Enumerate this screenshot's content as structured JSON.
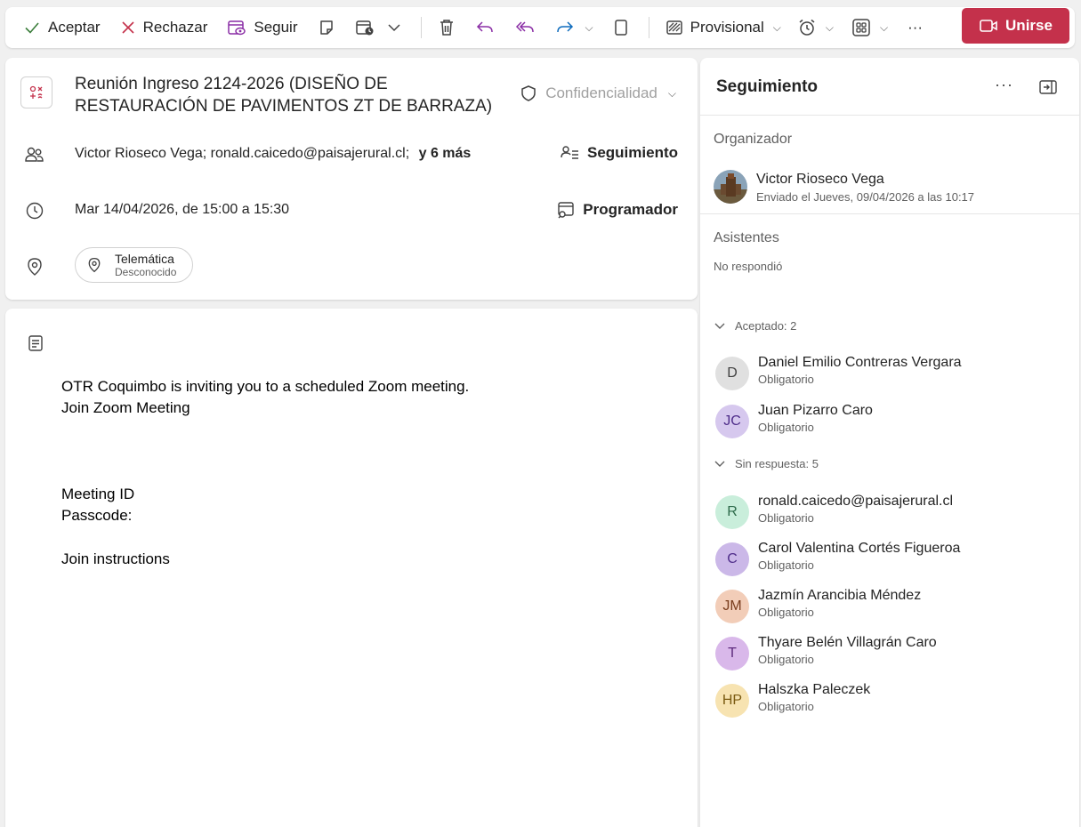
{
  "toolbar": {
    "accept": "Aceptar",
    "reject": "Rechazar",
    "follow": "Seguir",
    "provisional": "Provisional",
    "join": "Unirse",
    "more": "···"
  },
  "event": {
    "title": "Reunión Ingreso 2124-2026 (DISEÑO DE RESTAURACIÓN DE PAVIMENTOS ZT DE BARRAZA)",
    "confidentiality": "Confidencialidad",
    "attendees_summary": "Victor Rioseco Vega;  ronald.caicedo@paisajerural.cl;",
    "attendees_more": "y 6 más",
    "tracking_label": "Seguimiento",
    "datetime": "Mar 14/04/2026, de 15:00 a 15:30",
    "scheduler_label": "Programador",
    "location_name": "Telemática",
    "location_status": "Desconocido"
  },
  "body": {
    "line1": "OTR Coquimbo is inviting you to a scheduled Zoom meeting.",
    "line2": "Join Zoom Meeting",
    "line3": "Meeting ID",
    "line4": "Passcode:",
    "line5": "Join instructions"
  },
  "sidebar": {
    "title": "Seguimiento",
    "more": "···",
    "organizer_label": "Organizador",
    "organizer_name": "Victor Rioseco Vega",
    "organizer_sent": "Enviado el Jueves, 09/04/2026 a las 10:17",
    "attendees_label": "Asistentes",
    "no_response": "No respondió",
    "accepted_header": "Aceptado: 2",
    "pending_header": "Sin respuesta: 5",
    "accepted": [
      {
        "initials": "D",
        "name": "Daniel Emilio Contreras Vergara",
        "role": "Obligatorio",
        "color": "#e0e0e0",
        "text_color": "#424242"
      },
      {
        "initials": "JC",
        "name": "Juan Pizarro Caro",
        "role": "Obligatorio",
        "color": "#d6c8ee",
        "text_color": "#4f2d8a"
      }
    ],
    "pending": [
      {
        "initials": "R",
        "name": "ronald.caicedo@paisajerural.cl",
        "role": "Obligatorio",
        "color": "#c9eedb",
        "text_color": "#2e6b4b"
      },
      {
        "initials": "C",
        "name": "Carol Valentina Cortés Figueroa",
        "role": "Obligatorio",
        "color": "#cbb8e8",
        "text_color": "#4f2d8a"
      },
      {
        "initials": "JM",
        "name": "Jazmín Arancibia Méndez",
        "role": "Obligatorio",
        "color": "#f2cdb8",
        "text_color": "#7a3e1e"
      },
      {
        "initials": "T",
        "name": "Thyare Belén Villagrán Caro",
        "role": "Obligatorio",
        "color": "#d9b8ea",
        "text_color": "#5e2a7e"
      },
      {
        "initials": "HP",
        "name": "Halszka Paleczek",
        "role": "Obligatorio",
        "color": "#f7e3b1",
        "text_color": "#7a5a10"
      }
    ]
  },
  "colors": {
    "accent_red": "#c4314b",
    "accept_green": "#3a7d3a",
    "reject_red": "#c4314b",
    "follow_purple": "#8a2da5",
    "reply_purple": "#8a2da5",
    "forward_blue": "#0f6cbd"
  }
}
